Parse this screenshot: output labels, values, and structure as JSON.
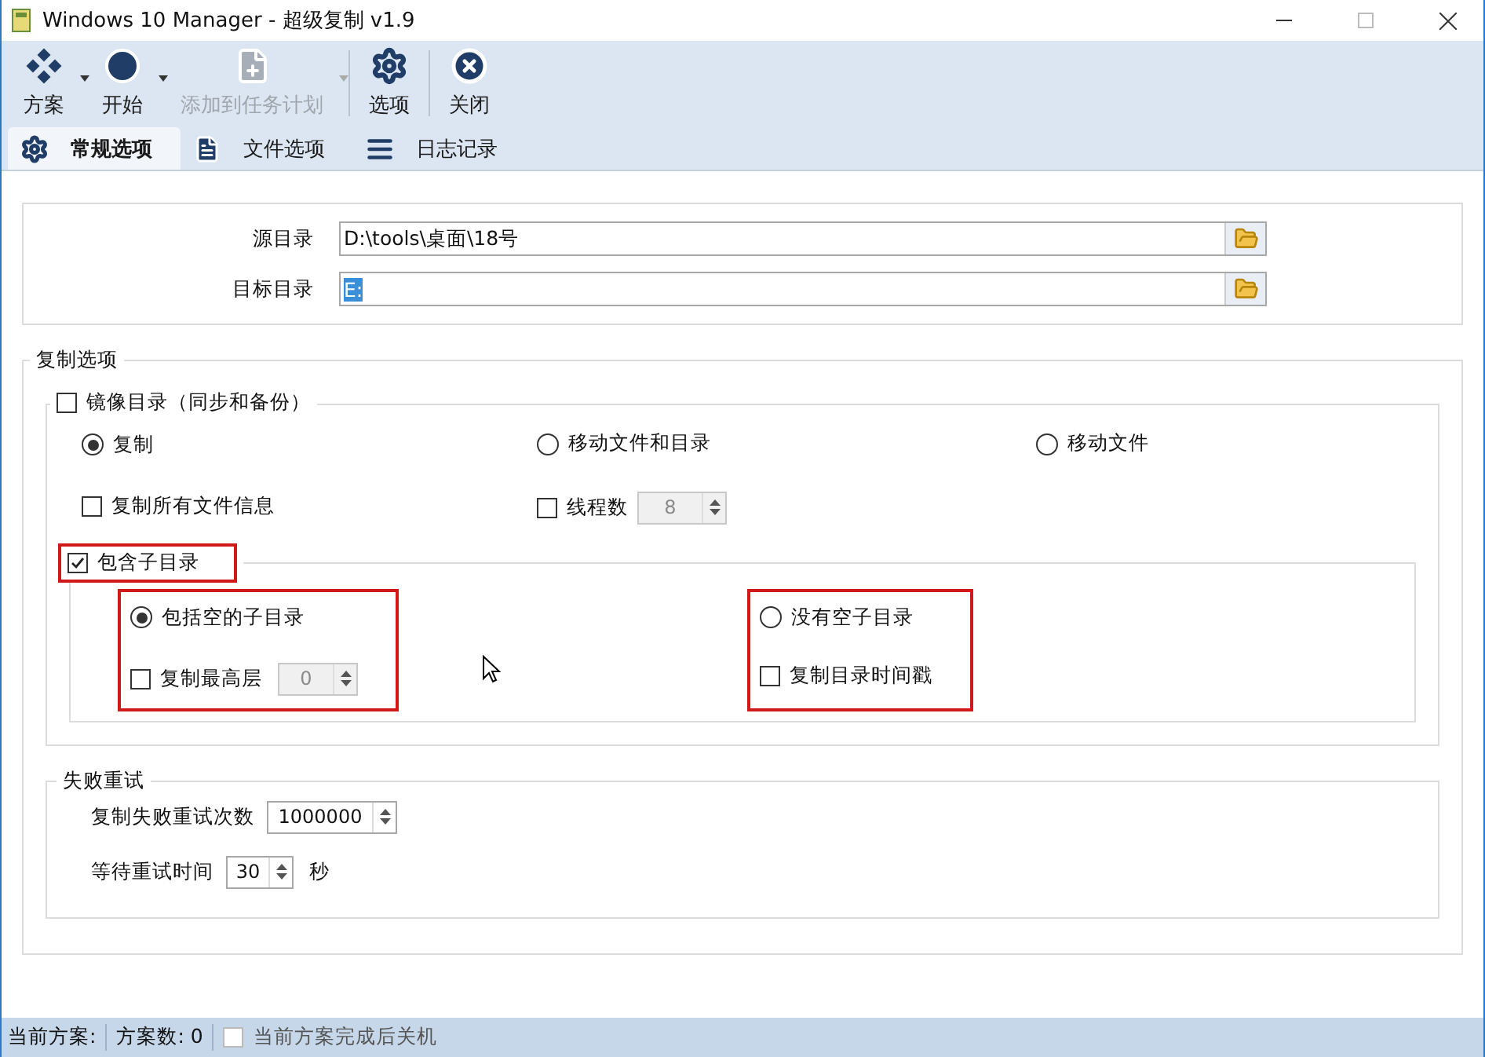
{
  "window": {
    "title": "Windows 10 Manager - 超级复制 v1.9"
  },
  "toolbar": [
    {
      "label": "方案",
      "dropdown": true,
      "disabled": false
    },
    {
      "label": "开始",
      "dropdown": true,
      "disabled": false
    },
    {
      "label": "添加到任务计划",
      "dropdown": true,
      "disabled": true
    },
    {
      "label": "选项",
      "dropdown": false,
      "disabled": false
    },
    {
      "label": "关闭",
      "dropdown": false,
      "disabled": false
    }
  ],
  "tabs": [
    {
      "label": "常规选项",
      "selected": true
    },
    {
      "label": "文件选项",
      "selected": false
    },
    {
      "label": "日志记录",
      "selected": false
    }
  ],
  "paths": [
    {
      "label": "源目录",
      "value": "D:\\tools\\桌面\\18号",
      "text_selected": false
    },
    {
      "label": "目标目录",
      "value": "E:",
      "text_selected": true
    }
  ],
  "copy_options": {
    "title": "复制选项",
    "mirror": {
      "label": "镜像目录（同步和备份）",
      "checked": false
    },
    "modes": [
      {
        "label": "复制",
        "selected": true
      },
      {
        "label": "移动文件和目录",
        "selected": false
      },
      {
        "label": "移动文件",
        "selected": false
      }
    ],
    "copy_all_info": {
      "label": "复制所有文件信息",
      "checked": false
    },
    "threads": {
      "label": "线程数",
      "checked": false,
      "value": "8",
      "disabled": true
    },
    "include_subdirs": {
      "label": "包含子目录",
      "checked": true,
      "highlighted": true
    },
    "subdir_columns": [
      {
        "highlighted": true,
        "radio": {
          "label": "包括空的子目录",
          "selected": true
        },
        "option": {
          "label": "复制最高层",
          "checked": false,
          "spinner": {
            "value": "0",
            "disabled": true
          }
        }
      },
      {
        "highlighted": true,
        "radio": {
          "label": "没有空子目录",
          "selected": false
        },
        "option": {
          "label": "复制目录时间戳",
          "checked": false
        }
      }
    ]
  },
  "retry": {
    "title": "失败重试",
    "rows": [
      {
        "label": "复制失败重试次数",
        "value": "1000000"
      },
      {
        "label": "等待重试时间",
        "value": "30",
        "unit": "秒"
      }
    ]
  },
  "status_bar": {
    "scheme": "当前方案:",
    "count": "方案数: 0",
    "shutdown": {
      "label": "当前方案完成后关机",
      "checked": false,
      "disabled": true
    }
  }
}
